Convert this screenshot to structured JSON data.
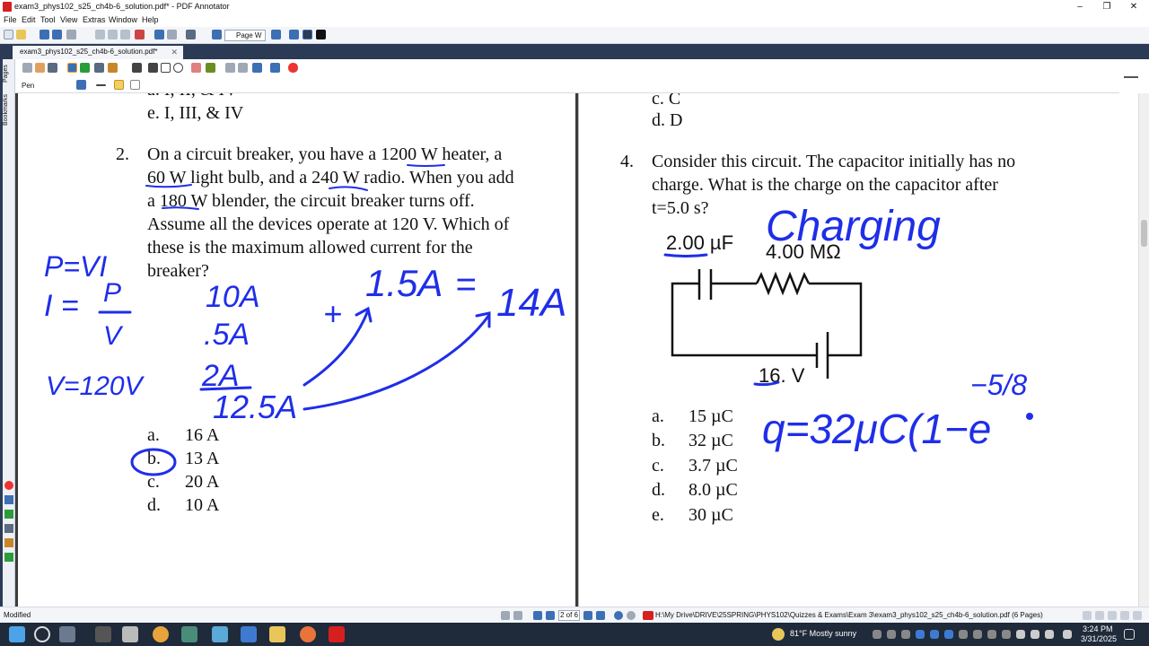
{
  "window": {
    "title": "exam3_phys102_s25_ch4b-6_solution.pdf* - PDF Annotator",
    "minimize": "–",
    "maximize": "❐",
    "close": "✕"
  },
  "menu": [
    "File",
    "Edit",
    "Tool",
    "View",
    "Extras",
    "Window",
    "Help"
  ],
  "toolbar": {
    "zoom_label": "Page W"
  },
  "tab": {
    "label": "exam3_phys102_s25_ch4b-6_solution.pdf*",
    "close": "✕"
  },
  "sidebar": {
    "pages": "Pages",
    "bookmarks": "Bookmarks"
  },
  "tool": {
    "label": "Pen"
  },
  "page_left": {
    "prev_a": "a.      I, II, & IV",
    "prev_e": "e.      I, III, & IV",
    "q2_number": "2.",
    "q2_lines": [
      "On a circuit breaker, you have a 1200 W heater, a",
      "60 W light bulb, and a 240 W radio.  When you add",
      "a 180 W blender, the circuit breaker turns off.",
      "Assume all the devices operate at 120 V.  Which of",
      "these is the maximum allowed current for the",
      "breaker?"
    ],
    "choices": [
      {
        "letter": "a.",
        "text": "16 A"
      },
      {
        "letter": "b.",
        "text": "13 A"
      },
      {
        "letter": "c.",
        "text": "20 A"
      },
      {
        "letter": "d.",
        "text": "10 A"
      }
    ],
    "ink": {
      "p_eq": "P=VI",
      "i_eq_lhs": "I =",
      "i_num": "P",
      "i_den": "V",
      "v_eq": "V=120V",
      "c1": "10A",
      "c2": ".5A",
      "c3": "2A",
      "sum": "12.5A",
      "plus": "+",
      "add": "1.5A",
      "equals": "=",
      "total": "14A"
    }
  },
  "page_right": {
    "prev_c": "c.      C",
    "prev_d": "d.      D",
    "q4_number": "4.",
    "q4_lines": [
      "Consider this circuit.  The capacitor initially has no",
      "charge.  What is the charge on the capacitor after",
      "t=5.0 s?"
    ],
    "circuit": {
      "capacitor": "2.00 µF",
      "resistor": "4.00 MΩ",
      "battery": "16. V"
    },
    "choices": [
      {
        "letter": "a.",
        "text": "15 µC"
      },
      {
        "letter": "b.",
        "text": "32 µC"
      },
      {
        "letter": "c.",
        "text": "3.7 µC"
      },
      {
        "letter": "d.",
        "text": "8.0 µC"
      },
      {
        "letter": "e.",
        "text": "30 µC"
      }
    ],
    "ink": {
      "charging": "Charging",
      "formula": "q=32μC(1−e",
      "exponent": "−5/8"
    }
  },
  "status": {
    "left": "Modified",
    "page_of": "2 of 6",
    "path": "H:\\My Drive\\DRIVE\\25SPRING\\PHYS102\\Quizzes & Exams\\Exam 3\\exam3_phys102_s25_ch4b-6_solution.pdf (6 Pages)"
  },
  "taskbar": {
    "weather": "81°F  Mostly sunny",
    "time": "3:24 PM",
    "date": "3/31/2025"
  },
  "colors": {
    "ink": "#1f2ee8",
    "chrome_dark": "#2b3a55",
    "accent": "#3d6fb4"
  }
}
